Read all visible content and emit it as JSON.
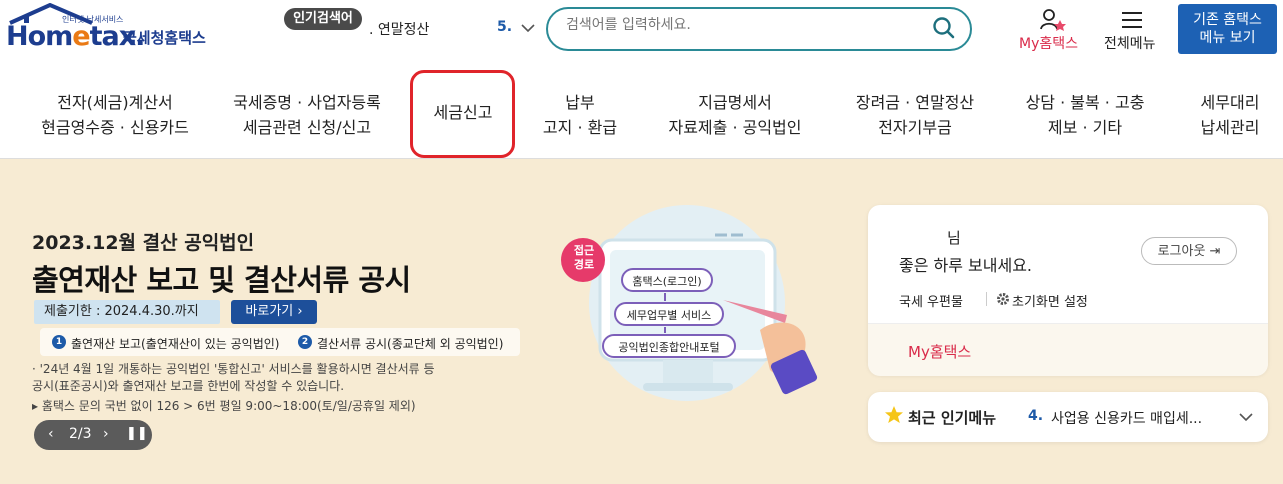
{
  "header": {
    "logo_small": "인터넷 납세서비스",
    "logo_main_a": "Hom",
    "logo_main_dot": "e",
    "logo_main_b": "tax.",
    "logo_sub": "국세청홈택스",
    "popular_badge": "인기검색어",
    "popular_text": ". 연말정산",
    "popular_rank": "5.",
    "search_placeholder": "검색어를 입력하세요.",
    "my_label": "My홈택스",
    "menu_label": "전체메뉴",
    "legacy_line1": "기존 홈택스",
    "legacy_line2": "메뉴 보기"
  },
  "nav": [
    {
      "line1": "전자(세금)계산서",
      "line2": "현금영수증 · 신용카드"
    },
    {
      "line1": "국세증명 · 사업자등록",
      "line2": "세금관련 신청/신고"
    },
    {
      "line1": "세금신고",
      "line2": ""
    },
    {
      "line1": "납부",
      "line2": "고지 · 환급"
    },
    {
      "line1": "지급명세서",
      "line2": "자료제출 · 공익법인"
    },
    {
      "line1": "장려금 · 연말정산",
      "line2": "전자기부금"
    },
    {
      "line1": "상담 · 불복 · 고충",
      "line2": "제보 · 기타"
    },
    {
      "line1": "세무대리",
      "line2": "납세관리"
    }
  ],
  "banner": {
    "date_line": "2023.12월 결산 공익법인",
    "title": "출연재산 보고 및 결산서류 공시",
    "deadline": "제출기한 : 2024.4.30.까지",
    "goto": "바로가기 ›",
    "item1_num": "1",
    "item1": "출연재산 보고(출연재산이 있는 공익법인)",
    "item2_num": "2",
    "item2": "결산서류 공시(종교단체 외 공익법인)",
    "note1": "· '24년 4월 1일 개통하는 공익법인 '통합신고' 서비스를 활용하시면 결산서류 등",
    "note2": "  공시(표준공시)와 출연재산 보고를 한번에 작성할 수 있습니다.",
    "note3": "▸ 홈택스 문의 국번 없이 126 > 6번 평일 9:00~18:00(토/일/공휴일 제외)",
    "pager_prev": "‹",
    "pager_num": "2/3",
    "pager_next": "›",
    "pager_pause": "❚❚"
  },
  "illustration": {
    "badge_line1": "접근",
    "badge_line2": "경로",
    "step1": "홈택스(로그인)",
    "step2": "세무업무별 서비스",
    "step3": "공익법인종합안내포털"
  },
  "user_card": {
    "name": "님",
    "greeting": "좋은 하루 보내세요.",
    "logout": "로그아웃 ⇥",
    "mail": "국세 우편물",
    "reset": "초기화면 설정",
    "my": "My홈택스"
  },
  "recent": {
    "title": "최근 인기메뉴",
    "rank": "4.",
    "text": "사업용 신용카드 매입세..."
  },
  "colors": {
    "brand_blue": "#1d3d8f",
    "accent_red": "#d92b4a",
    "highlight_red": "#e0242a",
    "banner_bg": "#f7ebd3",
    "search_border": "#2a8a96"
  }
}
